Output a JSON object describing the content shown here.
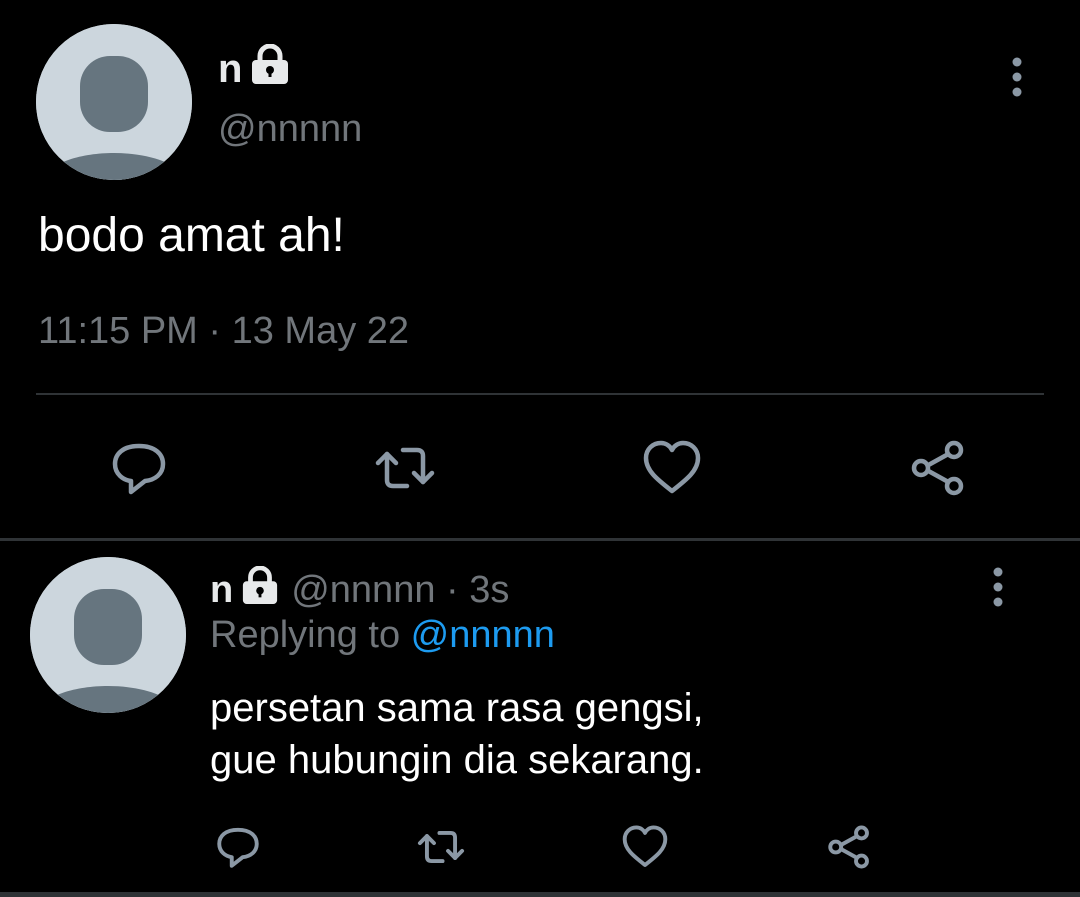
{
  "colors": {
    "background": "#000000",
    "primary_text": "#e7e9ea",
    "secondary_text": "#71767b",
    "link": "#1d9bf0",
    "divider": "#2f3336",
    "avatar_bg": "#ccd6dd",
    "avatar_fg": "#66757f"
  },
  "main_tweet": {
    "display_name": "n",
    "handle": "@nnnnn",
    "text": "bodo amat ah!",
    "timestamp": "11:15 PM · 13 May 22",
    "icons": {
      "lock": "lock-icon",
      "more": "more-vertical-icon",
      "actions": [
        "reply-icon",
        "retweet-icon",
        "like-icon",
        "share-icon"
      ]
    }
  },
  "reply_tweet": {
    "display_name": "n",
    "meta": "@nnnnn · 3s",
    "replying_prefix": "Replying to ",
    "replying_to": "@nnnnn",
    "text_lines": [
      "persetan sama rasa gengsi,",
      "gue hubungin dia sekarang."
    ],
    "icons": {
      "lock": "lock-icon",
      "more": "more-vertical-icon",
      "actions": [
        "reply-icon",
        "retweet-icon",
        "like-icon",
        "share-icon"
      ]
    }
  }
}
